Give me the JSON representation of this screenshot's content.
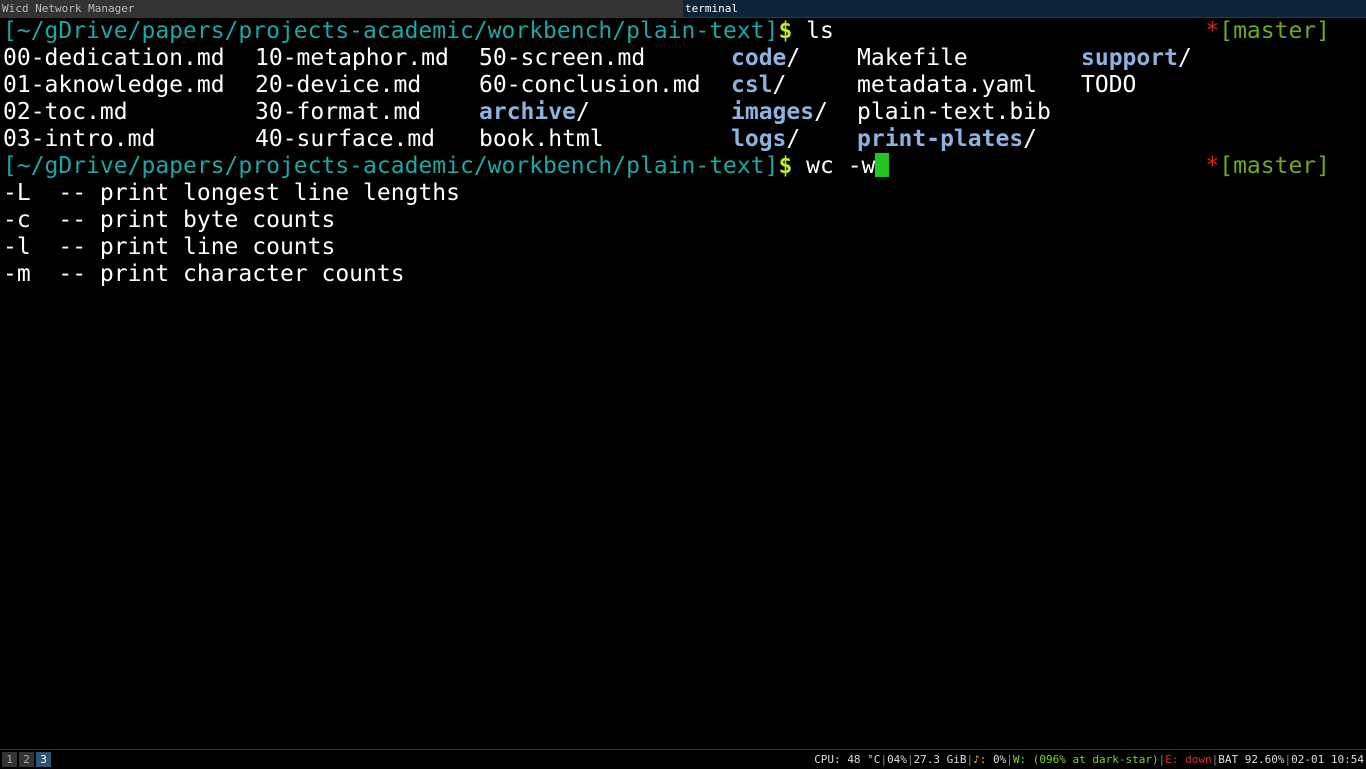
{
  "window_tabs": [
    "Wicd Network Manager",
    "terminal"
  ],
  "prompt": {
    "cwd": "[~/gDrive/papers/projects-academic/workbench/plain-text]",
    "symbol": "$",
    "git_dirty": "*",
    "git_branch": "[master]"
  },
  "commands": [
    "ls",
    "wc -w"
  ],
  "ls_output": {
    "col1": [
      "00-dedication.md",
      "01-aknowledge.md",
      "02-toc.md",
      "03-intro.md"
    ],
    "col2": [
      "10-metaphor.md",
      "20-device.md",
      "30-format.md",
      "40-surface.md"
    ],
    "col3": [
      "50-screen.md",
      "60-conclusion.md",
      "archive",
      "book.html"
    ],
    "col4": [
      "code",
      "csl",
      "images",
      "logs"
    ],
    "col5": [
      "Makefile",
      "metadata.yaml",
      "plain-text.bib",
      "print-plates"
    ],
    "col6": [
      "support",
      "TODO"
    ],
    "dir_suffix": "/"
  },
  "completions": [
    "-L  -- print longest line lengths",
    "-c  -- print byte counts",
    "-l  -- print line counts",
    "-m  -- print character counts"
  ],
  "colors": {
    "cwd": "#1ea5a5",
    "dir": "#8fb1e0",
    "prompt_symbol": "#bfeb28",
    "cursor": "#23c623"
  },
  "statusbar": {
    "workspaces": [
      "1",
      "2",
      "3"
    ],
    "active_workspace": "3",
    "cpu_label": "CPU:",
    "cpu_temp": "48 °C",
    "cpu_load": "04%",
    "memory": "27.3 GiB",
    "volume_icon": "♪:",
    "volume": "0%",
    "wifi_label": "W:",
    "wifi": "(096% at dark-star)",
    "eth_label": "E:",
    "eth": "down",
    "battery_label": "BAT",
    "battery": "92.60%",
    "datetime": "02-01 10:54"
  }
}
